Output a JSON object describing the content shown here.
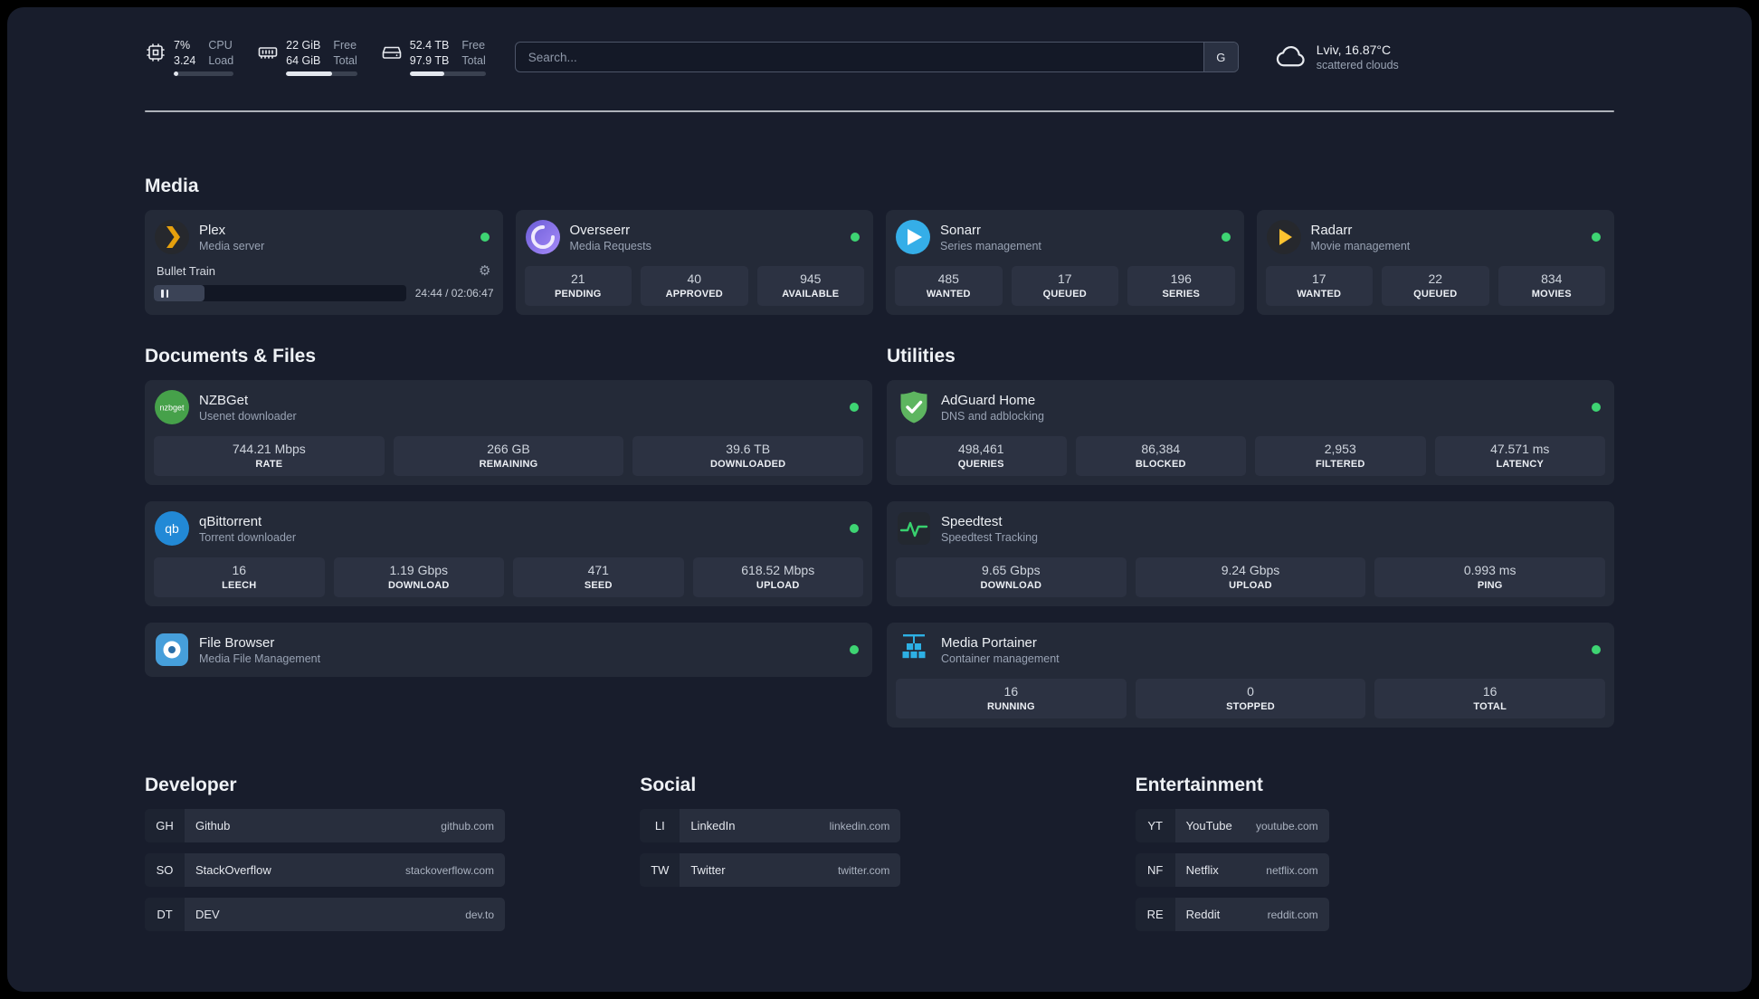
{
  "topbar": {
    "cpu": {
      "value": "7%",
      "load": "3.24",
      "label_top": "CPU",
      "label_bottom": "Load",
      "used_percent": 7
    },
    "memory": {
      "free": "22 GiB",
      "total": "64 GiB",
      "label_top": "Free",
      "label_bottom": "Total",
      "used_percent": 65
    },
    "disk": {
      "free": "52.4 TB",
      "total": "97.9 TB",
      "label_top": "Free",
      "label_bottom": "Total",
      "used_percent": 46
    },
    "search": {
      "placeholder": "Search...",
      "provider_button": "G"
    },
    "weather": {
      "location": "Lviv, 16.87°C",
      "condition": "scattered clouds"
    }
  },
  "sections": {
    "media": {
      "title": "Media",
      "plex": {
        "name": "Plex",
        "description": "Media server",
        "status": "online",
        "now_playing": {
          "title": "Bullet Train",
          "time_display": "24:44 / 02:06:47",
          "progress_percent": 20
        }
      },
      "overseerr": {
        "name": "Overseerr",
        "description": "Media Requests",
        "status": "online",
        "stats": [
          {
            "value": "21",
            "label": "PENDING"
          },
          {
            "value": "40",
            "label": "APPROVED"
          },
          {
            "value": "945",
            "label": "AVAILABLE"
          }
        ]
      },
      "sonarr": {
        "name": "Sonarr",
        "description": "Series management",
        "status": "online",
        "stats": [
          {
            "value": "485",
            "label": "WANTED"
          },
          {
            "value": "17",
            "label": "QUEUED"
          },
          {
            "value": "196",
            "label": "SERIES"
          }
        ]
      },
      "radarr": {
        "name": "Radarr",
        "description": "Movie management",
        "status": "online",
        "stats": [
          {
            "value": "17",
            "label": "WANTED"
          },
          {
            "value": "22",
            "label": "QUEUED"
          },
          {
            "value": "834",
            "label": "MOVIES"
          }
        ]
      }
    },
    "documents": {
      "title": "Documents & Files",
      "nzbget": {
        "name": "NZBGet",
        "description": "Usenet downloader",
        "status": "online",
        "stats": [
          {
            "value": "744.21 Mbps",
            "label": "RATE"
          },
          {
            "value": "266 GB",
            "label": "REMAINING"
          },
          {
            "value": "39.6 TB",
            "label": "DOWNLOADED"
          }
        ]
      },
      "qbittorrent": {
        "name": "qBittorrent",
        "description": "Torrent downloader",
        "status": "online",
        "stats": [
          {
            "value": "16",
            "label": "LEECH"
          },
          {
            "value": "1.19 Gbps",
            "label": "DOWNLOAD"
          },
          {
            "value": "471",
            "label": "SEED"
          },
          {
            "value": "618.52 Mbps",
            "label": "UPLOAD"
          }
        ]
      },
      "filebrowser": {
        "name": "File Browser",
        "description": "Media File Management",
        "status": "online"
      }
    },
    "utilities": {
      "title": "Utilities",
      "adguard": {
        "name": "AdGuard Home",
        "description": "DNS and adblocking",
        "status": "online",
        "stats": [
          {
            "value": "498,461",
            "label": "QUERIES"
          },
          {
            "value": "86,384",
            "label": "BLOCKED"
          },
          {
            "value": "2,953",
            "label": "FILTERED"
          },
          {
            "value": "47.571 ms",
            "label": "LATENCY"
          }
        ]
      },
      "speedtest": {
        "name": "Speedtest",
        "description": "Speedtest Tracking",
        "status": "online",
        "stats": [
          {
            "value": "9.65 Gbps",
            "label": "DOWNLOAD"
          },
          {
            "value": "9.24 Gbps",
            "label": "UPLOAD"
          },
          {
            "value": "0.993 ms",
            "label": "PING"
          }
        ]
      },
      "portainer": {
        "name": "Media Portainer",
        "description": "Container management",
        "status": "online",
        "stats": [
          {
            "value": "16",
            "label": "RUNNING"
          },
          {
            "value": "0",
            "label": "STOPPED"
          },
          {
            "value": "16",
            "label": "TOTAL"
          }
        ]
      }
    },
    "bookmarks": {
      "developer": {
        "title": "Developer",
        "items": [
          {
            "abbr": "GH",
            "name": "Github",
            "url": "github.com"
          },
          {
            "abbr": "SO",
            "name": "StackOverflow",
            "url": "stackoverflow.com"
          },
          {
            "abbr": "DT",
            "name": "DEV",
            "url": "dev.to"
          }
        ]
      },
      "social": {
        "title": "Social",
        "items": [
          {
            "abbr": "LI",
            "name": "LinkedIn",
            "url": "linkedin.com"
          },
          {
            "abbr": "TW",
            "name": "Twitter",
            "url": "twitter.com"
          }
        ]
      },
      "entertainment": {
        "title": "Entertainment",
        "items": [
          {
            "abbr": "YT",
            "name": "YouTube",
            "url": "youtube.com"
          },
          {
            "abbr": "NF",
            "name": "Netflix",
            "url": "netflix.com"
          },
          {
            "abbr": "RE",
            "name": "Reddit",
            "url": "reddit.com"
          }
        ]
      }
    }
  },
  "icons": {
    "gear": "⚙"
  },
  "colors": {
    "status_online": "#3ed473",
    "plex_accent": "#e5a00d",
    "page_bg": "#181d2c",
    "card_bg": "#242a38"
  }
}
